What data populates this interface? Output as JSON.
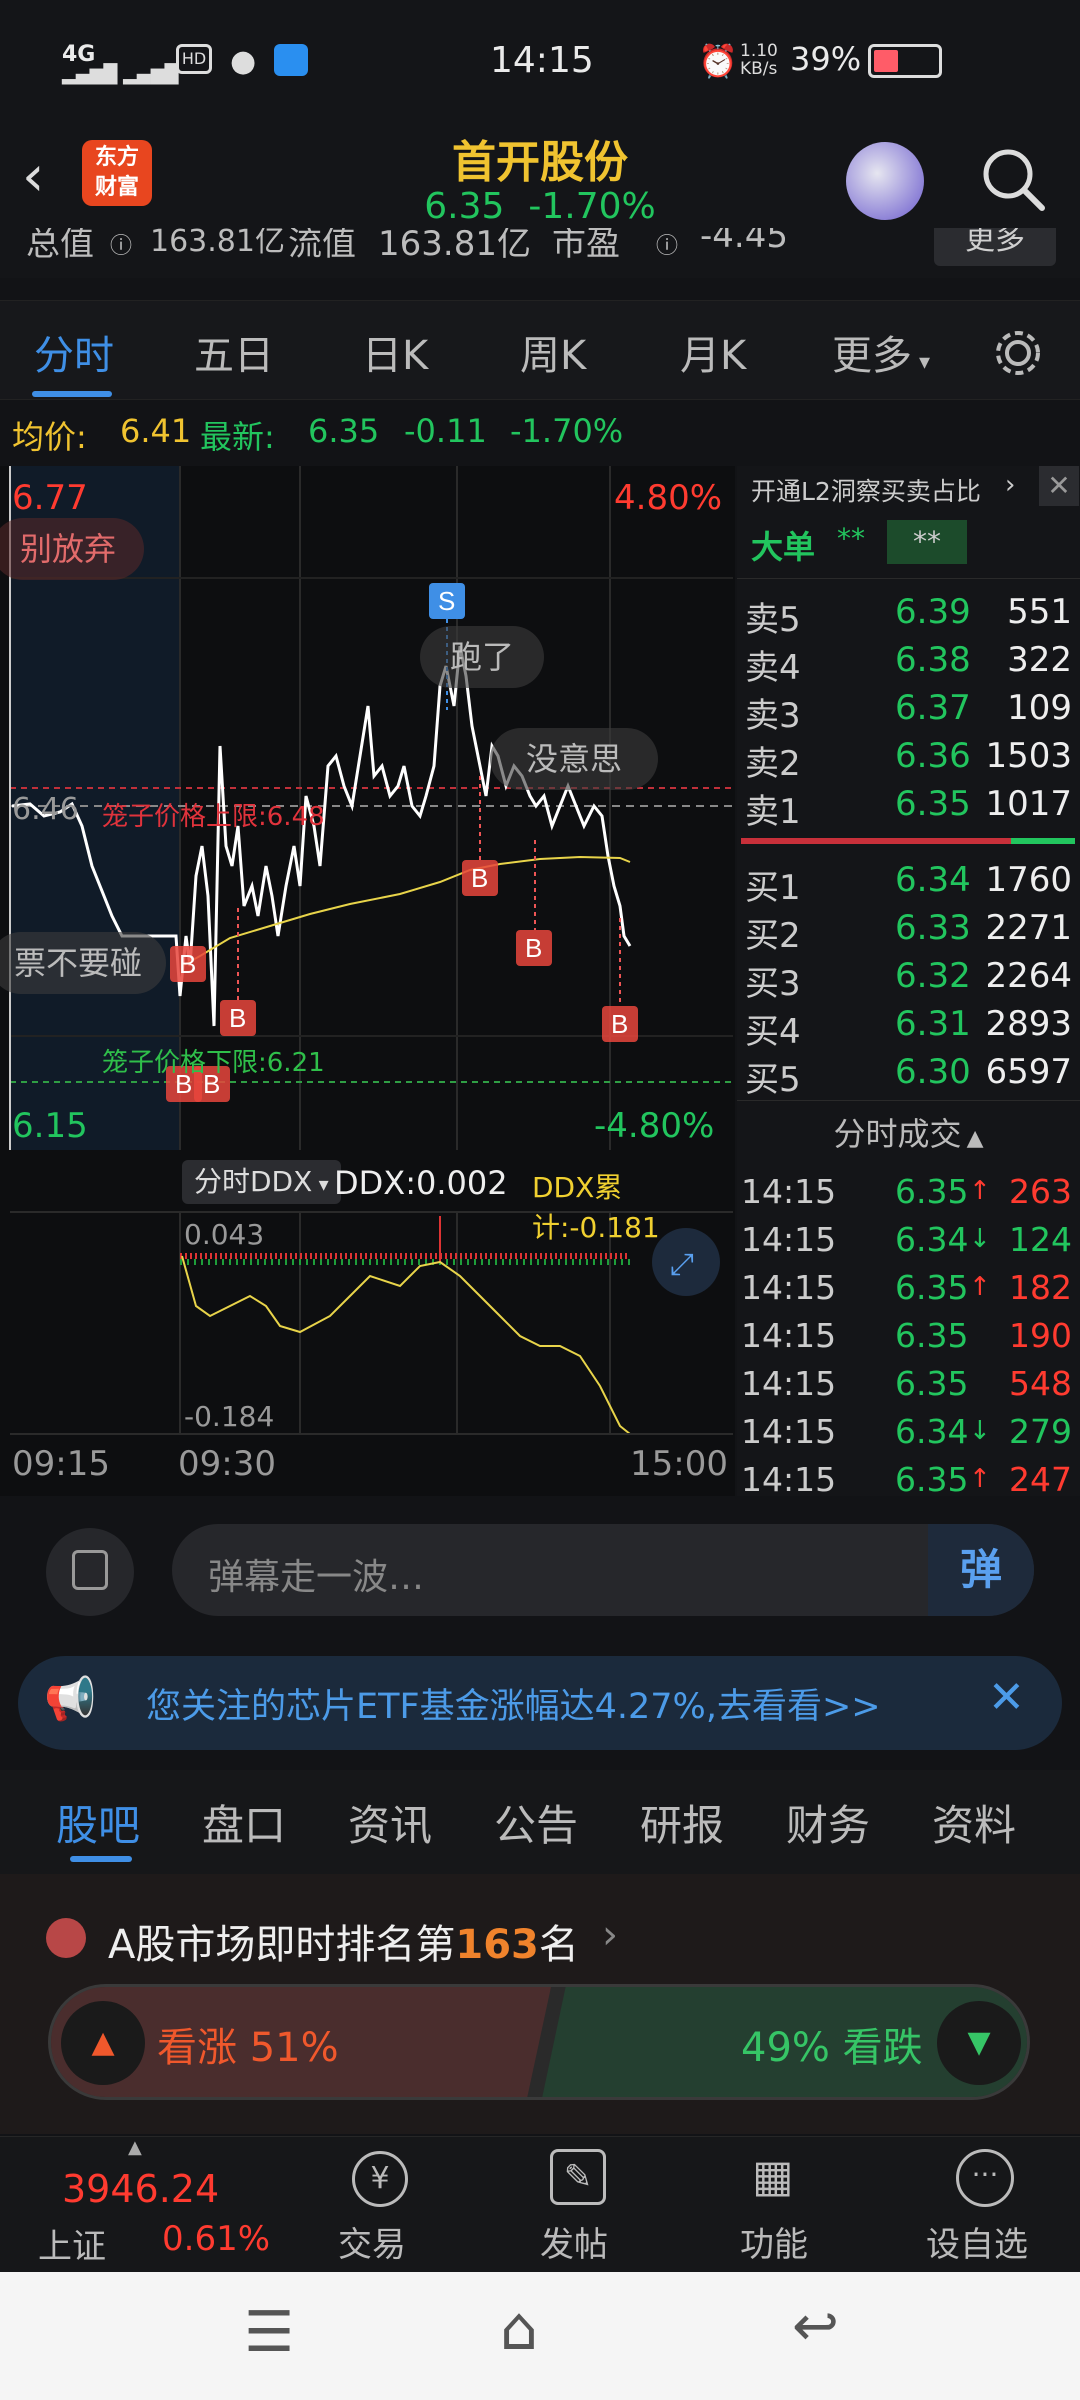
{
  "status_bar": {
    "signal": "4G",
    "time": "14:15",
    "net_speed_value": "1.10",
    "net_speed_unit": "KB/s",
    "battery": "39%"
  },
  "header": {
    "logo_line1": "东方",
    "logo_line2": "财富",
    "title": "首开股份",
    "price": "6.35",
    "change_pct": "-1.70%"
  },
  "metrics": {
    "total_value_label": "总值",
    "total_value": "163.81亿",
    "float_value_label": "流值",
    "float_value": "163.81亿",
    "pe_label": "市盈",
    "pe": "-4.45",
    "more": "更多"
  },
  "chart_tabs": [
    "分时",
    "五日",
    "日K",
    "周K",
    "月K",
    "更多"
  ],
  "avg_line": {
    "avg_label": "均价:",
    "avg_value": "6.41",
    "latest_label": "最新:",
    "latest_value": "6.35",
    "change": "-0.11",
    "change_pct": "-1.70%"
  },
  "chart_labels": {
    "high_price": "6.77",
    "high_pct": "4.80%",
    "low_price": "6.15",
    "low_pct": "-4.80%",
    "ref_price": "6.46",
    "upper_cage": "笼子价格上限:6.48",
    "lower_cage": "笼子价格下限:6.21",
    "bullet1": "别放弃",
    "bullet2": "跑了",
    "bullet3": "没意思",
    "bullet4": "票不要碰",
    "ddx_selector": "分时DDX",
    "ddx_value": "DDX:0.002",
    "ddx_cum": "DDX累计:-0.181",
    "ddx_top": "0.043",
    "ddx_bottom": "-0.184",
    "time_start": "09:15",
    "time_open": "09:30",
    "time_end": "15:00"
  },
  "order_book": {
    "l2_title": "开通L2洞察买卖占比",
    "big_order_label": "大单",
    "big_order_v1": "**",
    "big_order_v2": "**",
    "sells": [
      {
        "label": "卖5",
        "price": "6.39",
        "vol": "551"
      },
      {
        "label": "卖4",
        "price": "6.38",
        "vol": "322"
      },
      {
        "label": "卖3",
        "price": "6.37",
        "vol": "109"
      },
      {
        "label": "卖2",
        "price": "6.36",
        "vol": "1503"
      },
      {
        "label": "卖1",
        "price": "6.35",
        "vol": "1017"
      }
    ],
    "buys": [
      {
        "label": "买1",
        "price": "6.34",
        "vol": "1760"
      },
      {
        "label": "买2",
        "price": "6.33",
        "vol": "2271"
      },
      {
        "label": "买3",
        "price": "6.32",
        "vol": "2264"
      },
      {
        "label": "买4",
        "price": "6.31",
        "vol": "2893"
      },
      {
        "label": "买5",
        "price": "6.30",
        "vol": "6597"
      }
    ],
    "trades_title": "分时成交",
    "trades": [
      {
        "time": "14:15",
        "price": "6.35",
        "dir": "↑",
        "vol": "263"
      },
      {
        "time": "14:15",
        "price": "6.34",
        "dir": "↓",
        "vol": "124"
      },
      {
        "time": "14:15",
        "price": "6.35",
        "dir": "↑",
        "vol": "182"
      },
      {
        "time": "14:15",
        "price": "6.35",
        "dir": "",
        "vol": "190"
      },
      {
        "time": "14:15",
        "price": "6.35",
        "dir": "",
        "vol": "548"
      },
      {
        "time": "14:15",
        "price": "6.34",
        "dir": "↓",
        "vol": "279"
      },
      {
        "time": "14:15",
        "price": "6.35",
        "dir": "↑",
        "vol": "247"
      }
    ]
  },
  "danmu": {
    "placeholder": "弹幕走一波…",
    "send_label": "弹"
  },
  "notice": {
    "text": "您关注的芯片ETF基金涨幅达4.27%,去看看>>"
  },
  "content_tabs": [
    "股吧",
    "盘口",
    "资讯",
    "公告",
    "研报",
    "财务",
    "资料"
  ],
  "rank": {
    "prefix": "A股市场即时排名第",
    "number": "163",
    "suffix": "名",
    "up_label": "看涨",
    "up_pct": "51%",
    "down_pct": "49%",
    "down_label": "看跌"
  },
  "bottom_nav": {
    "index_value": "3946.24",
    "index_name": "上证",
    "index_pct": "0.61%",
    "items": [
      "交易",
      "发帖",
      "功能",
      "设自选"
    ]
  },
  "colors": {
    "up": "#ff3b30",
    "down": "#22c55e",
    "accent": "#3f8fe6",
    "title": "#f0c330"
  }
}
